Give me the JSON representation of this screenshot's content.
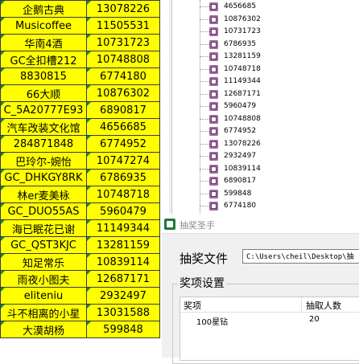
{
  "sheet": {
    "rows": [
      {
        "name": "企鹅古典",
        "id": "13078226"
      },
      {
        "name": "Musicoffee",
        "id": "11505531"
      },
      {
        "name": "华南4酒",
        "id": "10731723"
      },
      {
        "name": "GC全扣槽212",
        "id": "10748808"
      },
      {
        "name": "8830815",
        "id": "6774180"
      },
      {
        "name": "66大顺",
        "id": "10876302"
      },
      {
        "name": "C_5A20777E93",
        "id": "6890817"
      },
      {
        "name": "汽车改装文化馆",
        "id": "4656685"
      },
      {
        "name": "284871848",
        "id": "6774952"
      },
      {
        "name": "巴玲尔-婉怡",
        "id": "10747274"
      },
      {
        "name": "GC_DHKGY8RK",
        "id": "6786935"
      },
      {
        "name": "林er麦美栐",
        "id": "10748718"
      },
      {
        "name": "GC_DUO55AS",
        "id": "5960479"
      },
      {
        "name": "海已眠花已谢",
        "id": "11149344"
      },
      {
        "name": "GC_QST3KJC",
        "id": "13281159"
      },
      {
        "name": "知足常乐",
        "id": "10839114"
      },
      {
        "name": "雨夜小图夫",
        "id": "12687171"
      },
      {
        "name": "eliteniu",
        "id": "2932497"
      },
      {
        "name": "斗不相离的小星",
        "id": "13031588"
      },
      {
        "name": "大漠胡杨",
        "id": "599848"
      }
    ]
  },
  "tree": {
    "items": [
      "4656685",
      "10876302",
      "10731723",
      "6786935",
      "13281159",
      "10748718",
      "11149344",
      "12687171",
      "5960479",
      "10748808",
      "6774952",
      "13078226",
      "2932497",
      "10839114",
      "6890817",
      "599848",
      "6774180"
    ]
  },
  "dialog": {
    "title": "抽奖圣手",
    "file_label": "抽奖文件",
    "file_path": "C:\\Users\\cheil\\Desktop\\抽",
    "group_label": "奖项设置",
    "columns": [
      "奖项",
      "抽取人数"
    ],
    "prizes": [
      {
        "prize": "100星钻",
        "count": "20"
      }
    ]
  }
}
